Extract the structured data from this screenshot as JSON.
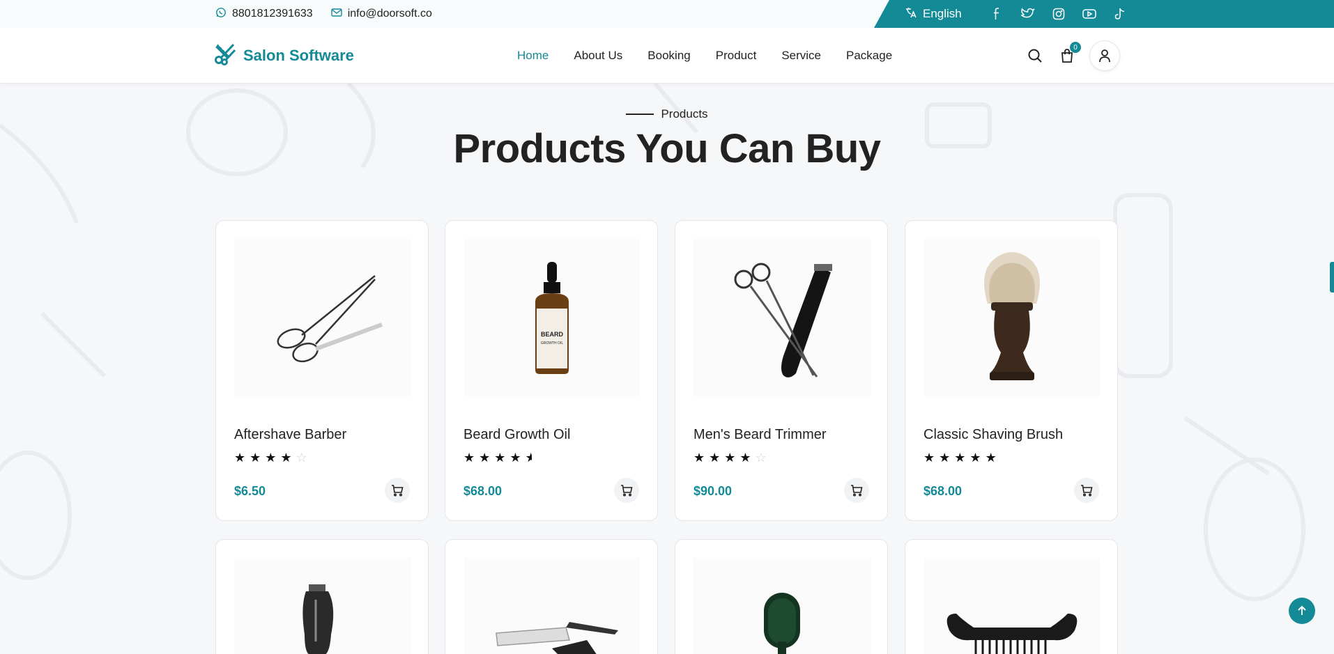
{
  "topbar": {
    "phone": "8801812391633",
    "email": "info@doorsoft.co",
    "language": "English",
    "socials": [
      "facebook-icon",
      "twitter-icon",
      "instagram-icon",
      "youtube-icon",
      "tiktok-icon"
    ]
  },
  "header": {
    "brand": "Salon Software",
    "nav": [
      "Home",
      "About Us",
      "Booking",
      "Product",
      "Service",
      "Package"
    ],
    "active_nav": "Home",
    "cart_count": "0"
  },
  "section": {
    "eyebrow": "Products",
    "title": "Products You Can Buy"
  },
  "products": [
    {
      "name": "Aftershave Barber",
      "price": "$6.50",
      "rating": 4,
      "icon": "scissors-image"
    },
    {
      "name": "Beard Growth Oil",
      "price": "$68.00",
      "rating": 4.5,
      "icon": "beard-oil-bottle-image"
    },
    {
      "name": "Men's Beard Trimmer",
      "price": "$90.00",
      "rating": 4,
      "icon": "scissors-trimmer-image"
    },
    {
      "name": "Classic Shaving Brush",
      "price": "$68.00",
      "rating": 5,
      "icon": "shaving-brush-image"
    },
    {
      "icon": "hair-clipper-image"
    },
    {
      "icon": "straight-razor-image"
    },
    {
      "icon": "hair-brush-image"
    },
    {
      "icon": "mustache-comb-image"
    }
  ],
  "colors": {
    "accent": "#148a96",
    "text": "#222222",
    "background": "#f6f7f9"
  }
}
